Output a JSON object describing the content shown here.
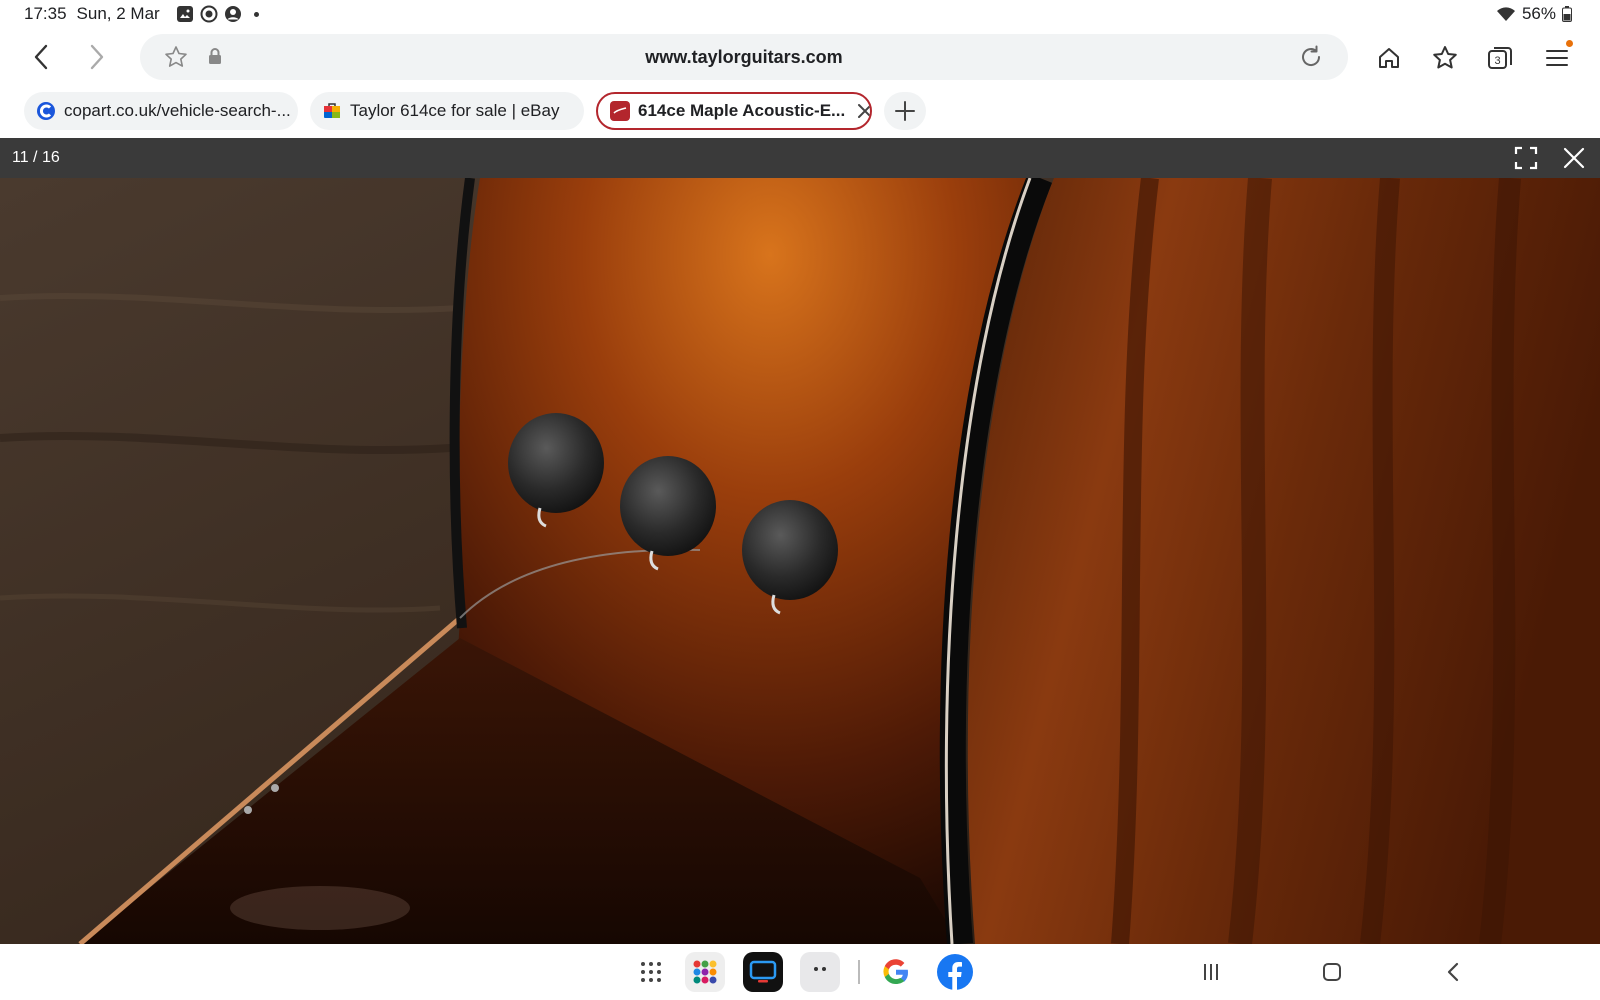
{
  "status": {
    "time": "17:35",
    "date": "Sun, 2 Mar",
    "battery": "56%"
  },
  "browser": {
    "url": "www.taylorguitars.com",
    "tab_count": "3",
    "tabs": [
      {
        "label": "copart.co.uk/vehicle-search-...",
        "icon": "copart-favicon"
      },
      {
        "label": "Taylor 614ce for sale | eBay",
        "icon": "ebay-favicon"
      },
      {
        "label": "614ce Maple Acoustic-E...",
        "icon": "taylor-favicon",
        "active": true
      }
    ]
  },
  "viewer": {
    "counter": "11 / 16"
  },
  "taskbar": {
    "apps": [
      "app-drawer-icon",
      "app-folder-icon",
      "tv-app-icon",
      "chat-app-icon",
      "google-icon",
      "facebook-icon"
    ]
  },
  "colors": {
    "active_tab_border": "#b3262d",
    "facebook_blue": "#1877f2",
    "copart_blue": "#1a56db"
  }
}
